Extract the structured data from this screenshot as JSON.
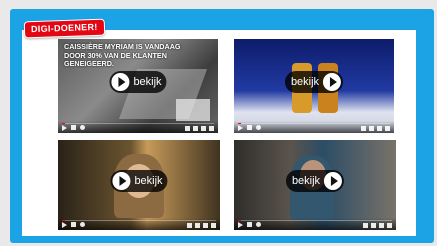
{
  "badge": {
    "label": "DIGI-DOENER!"
  },
  "videos": [
    {
      "caption_line1": "Caissière Myriam is vandaag",
      "caption_pre": "door ",
      "caption_highlight": "30%",
      "caption_post": " van de klanten",
      "caption_line3": "geneigeerd.",
      "play_label": "bekijk",
      "icon_position": "left"
    },
    {
      "play_label": "bekijk",
      "icon_position": "right"
    },
    {
      "play_label": "bekijk",
      "icon_position": "left"
    },
    {
      "play_label": "bekijk",
      "icon_position": "right"
    }
  ],
  "colors": {
    "frame": "#1ba3e6",
    "badge": "#e30613",
    "progress": "#ff0000"
  }
}
